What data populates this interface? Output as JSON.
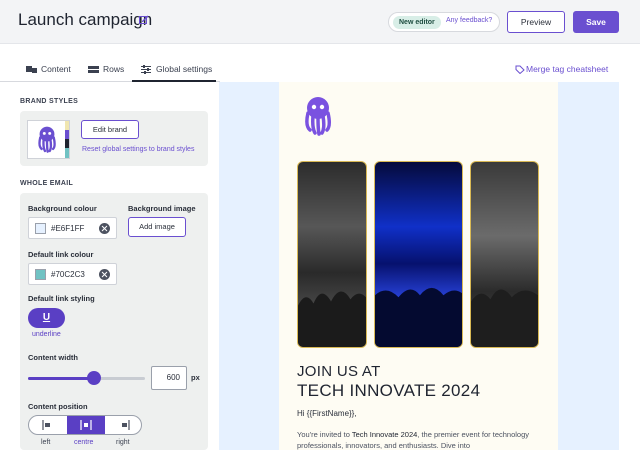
{
  "header": {
    "title": "Launch campaign",
    "badge": "New editor",
    "feedback_link": "Any feedback?",
    "preview_label": "Preview",
    "save_label": "Save"
  },
  "tabs": [
    {
      "label": "Content",
      "icon": "blocks-icon"
    },
    {
      "label": "Rows",
      "icon": "rows-icon"
    },
    {
      "label": "Global settings",
      "icon": "sliders-icon",
      "active": true
    }
  ],
  "merge_link": "Merge tag cheatsheet",
  "sidebar": {
    "brand_styles": {
      "heading": "BRAND STYLES",
      "edit_label": "Edit brand",
      "reset_link": "Reset global settings to brand styles"
    },
    "whole_email": {
      "heading": "WHOLE EMAIL",
      "bg_colour_label": "Background colour",
      "bg_colour_value": "#E6F1FF",
      "bg_image_label": "Background image",
      "add_image_label": "Add image",
      "link_colour_label": "Default link colour",
      "link_colour_value": "#70C2C3",
      "link_styling_label": "Default link styling",
      "link_styling_value": "underline",
      "content_width_label": "Content width",
      "content_width_value": "600",
      "content_width_unit": "px",
      "content_width_fraction": 0.56,
      "content_position_label": "Content position",
      "positions": [
        "left",
        "centre",
        "right"
      ],
      "position_selected": "centre"
    }
  },
  "email": {
    "headline_1": "JOIN US AT",
    "headline_2": "TECH INNOVATE 2024",
    "greeting": "Hi {{FirstName}},",
    "body_prefix": "You're invited to ",
    "body_event": "Tech Innovate 2024",
    "body_suffix": ", the premier event for technology professionals, innovators, and enthusiasts. Dive into"
  },
  "colors": {
    "accent": "#6A4FD0",
    "preview_background": "#E6F1FF",
    "link_colour": "#70C2C3",
    "email_background": "#FEFCF3",
    "photo_border": "#D9B955"
  }
}
